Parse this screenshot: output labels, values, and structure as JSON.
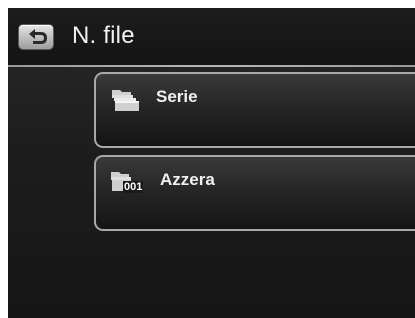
{
  "header": {
    "title": "N. file",
    "back_icon": "back-arrow-icon"
  },
  "menu": {
    "items": [
      {
        "label": "Serie",
        "icon": "folder-stack-icon"
      },
      {
        "label": "Azzera",
        "icon": "folder-reset-001-icon",
        "icon_text": "001"
      }
    ]
  },
  "colors": {
    "background": "#1d1d1d",
    "header_background": "#141414",
    "divider": "#b0b0b0",
    "text": "#f2f2f2",
    "item_border": "#a8a8a8"
  }
}
